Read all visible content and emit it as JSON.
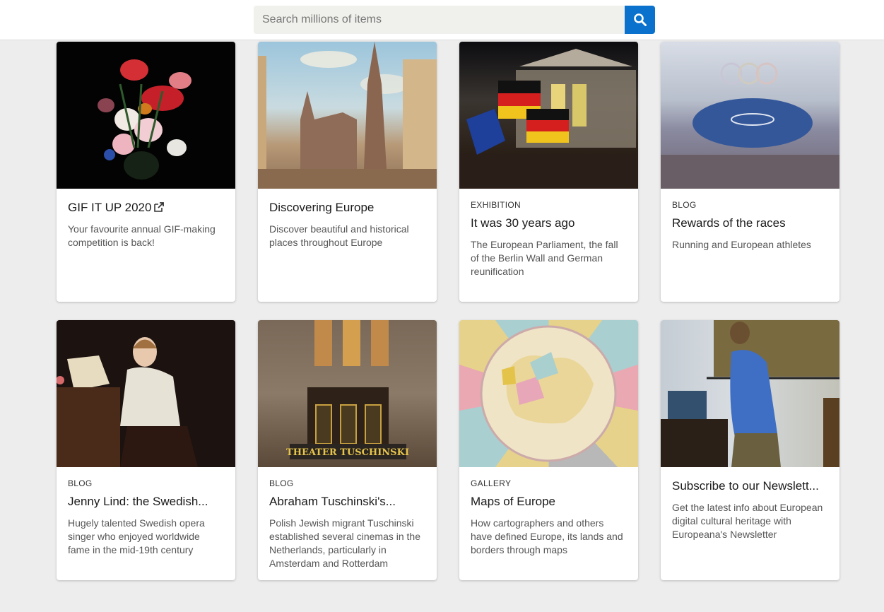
{
  "search": {
    "placeholder": "Search millions of items",
    "value": "",
    "button_icon": "search-icon"
  },
  "colors": {
    "accent": "#0a72cc",
    "page_background": "#ededed",
    "card_background": "#ffffff"
  },
  "cards": [
    {
      "tag": "",
      "title": "GIF IT UP 2020",
      "external_link_icon": "external-link-icon",
      "description": "Your favourite annual GIF-making competition is back!",
      "image": "Still life painting of flowers in a glass vase on black background"
    },
    {
      "tag": "",
      "title": "Discovering Europe",
      "description": "Discover beautiful and historical places throughout Europe",
      "image": "Painting of St. Stephen's Cathedral in Vienna with square"
    },
    {
      "tag": "EXHIBITION",
      "title": "It was 30 years ago",
      "description": "The European Parliament, the fall of the Berlin Wall and German reunification",
      "image": "Crowd waving German and EU flags in front of the Reichstag at night"
    },
    {
      "tag": "BLOG",
      "title": "Rewards of the races",
      "description": "Running and European athletes",
      "image": "Olympic stadium opening ceremony with Olympic rings"
    },
    {
      "tag": "BLOG",
      "title": "Jenny Lind: the Swedish...",
      "description": "Hugely talented Swedish opera singer who enjoyed worldwide fame in the mid-19th century",
      "image": "Portrait of a young woman playing piano"
    },
    {
      "tag": "BLOG",
      "title": "Abraham Tuschinski's...",
      "description": "Polish Jewish migrant Tuschinski established several cinemas in the Netherlands, particularly in Amsterdam and Rotterdam",
      "image": "Art deco facade of Theater Tuschinski",
      "image_text": "THEATER TUSCHINSKI"
    },
    {
      "tag": "GALLERY",
      "title": "Maps of Europe",
      "description": "How cartographers and others have defined Europe, its lands and borders through maps",
      "image": "Antique circular map of Europe with colored border panels"
    },
    {
      "tag": "",
      "title": "Subscribe to our Newslett...",
      "description": "Get the latest info about European digital cultural heritage with Europeana's Newsletter",
      "image": "Vermeer painting of woman in blue reading a letter"
    }
  ]
}
